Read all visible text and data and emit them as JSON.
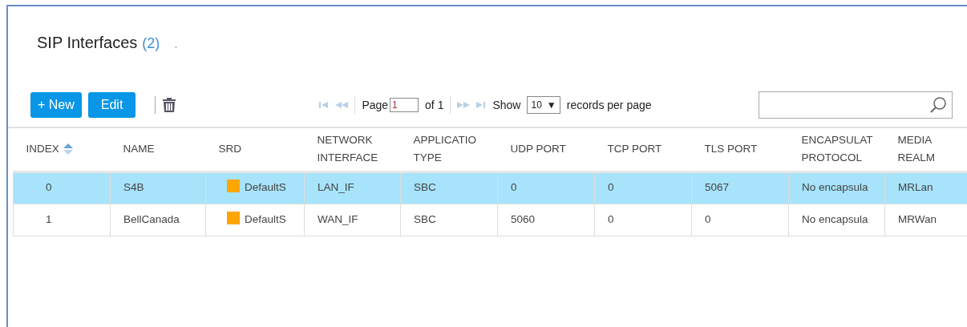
{
  "title": "SIP Interfaces",
  "count": "(2)",
  "status_dot": ".",
  "toolbar": {
    "new_button": "+ New",
    "edit_button": "Edit"
  },
  "pager": {
    "page_label": "Page",
    "page_value": "1",
    "of_label": "of 1",
    "show_label": "Show",
    "per_page": "10",
    "per_page_caret": "▼",
    "records_label": "records per page"
  },
  "table": {
    "columns": [
      {
        "label": "INDEX",
        "sorted": true
      },
      {
        "label": "NAME",
        "sorted": false
      },
      {
        "label": "SRD",
        "sorted": false
      },
      {
        "label": "NETWORK\nINTERFACE",
        "sorted": false
      },
      {
        "label": "APPLICATIO\nTYPE",
        "sorted": false
      },
      {
        "label": "UDP PORT",
        "sorted": false
      },
      {
        "label": "TCP PORT",
        "sorted": false
      },
      {
        "label": "TLS PORT",
        "sorted": false
      },
      {
        "label": "ENCAPSULAT\nPROTOCOL",
        "sorted": false
      },
      {
        "label": "MEDIA\nREALM",
        "sorted": false
      }
    ],
    "rows": [
      {
        "selected": true,
        "color": "#ffa500",
        "cells": [
          "0",
          "S4B",
          "DefaultS",
          "LAN_IF",
          "SBC",
          "0",
          "0",
          "5067",
          "No encapsula",
          "MRLan"
        ]
      },
      {
        "selected": false,
        "color": "#ffa500",
        "cells": [
          "1",
          "BellCanada",
          "DefaultS",
          "WAN_IF",
          "SBC",
          "5060",
          "0",
          "0",
          "No encapsula",
          "MRWan"
        ]
      }
    ]
  }
}
